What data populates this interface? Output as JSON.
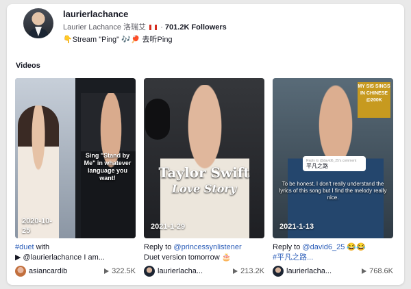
{
  "profile": {
    "username": "laurierlachance",
    "display_name": "Laurier Lachance 洛瑞艾",
    "followers": "701.2K Followers",
    "separator": "·",
    "bio": "👇Stream \"Ping\" 🎶🏓 去听Ping"
  },
  "videos_section_title": "Videos",
  "videos": [
    {
      "date_line1": "2020-10-",
      "date_line2": "25",
      "overlay": "Sing \"Stand by Me\" in whatever language you want!",
      "desc_link1": "#duet",
      "desc_text1": " with",
      "desc_link2": "▶ @laurierlachance",
      "desc_text2": " I am...",
      "author": "asiancardib",
      "views": "322.5K"
    },
    {
      "date": "2021-1-29",
      "overlay_title": "Taylor Swift",
      "overlay_sub": "Love Story",
      "desc_text1": "Reply to ",
      "desc_link1": "@princessynlistener",
      "desc_text2": "Duet version tomorrow 🎂",
      "author": "laurierlacha...",
      "views": "213.2K"
    },
    {
      "date": "2021-1-13",
      "tag_text": "MY SIS SINGS IN CHINESE @200K",
      "reply_card_top": "Reply to @david6_25's comment",
      "reply_card_text": "平凡之路",
      "quote": "To be honest, I don't really understand the lyrics of this song but I find the melody really nice.",
      "desc_text1": "Reply to ",
      "desc_link1": "@david6_25",
      "desc_text2": " 😂😂",
      "desc_link2": "#平凡之路...",
      "author": "laurierlacha...",
      "views": "768.6K"
    }
  ]
}
